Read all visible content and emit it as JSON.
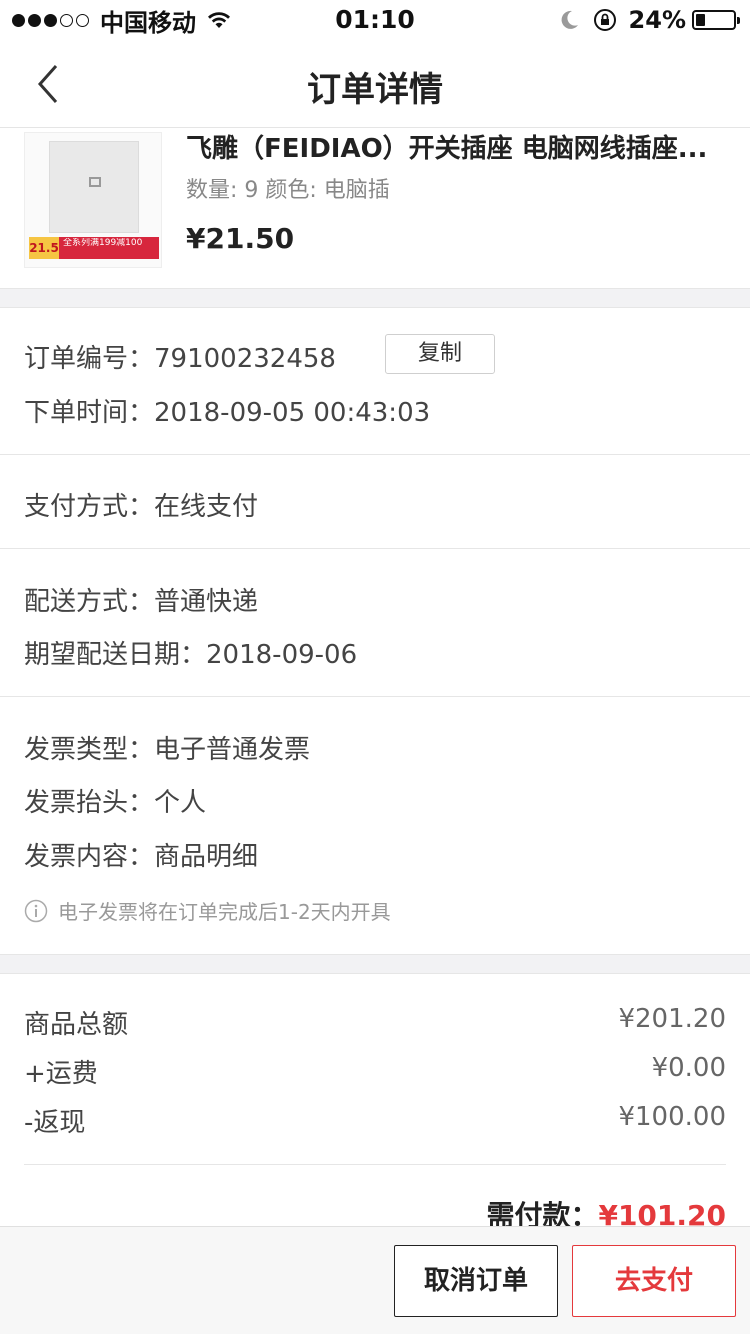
{
  "status_bar": {
    "carrier": "中国移动",
    "time": "01:10",
    "battery_percent": "24%",
    "battery_level": 0.24,
    "signal_bars_filled": 3,
    "signal_bars_total": 5,
    "icons": [
      "wifi-icon",
      "moon-icon",
      "orientation-lock-icon",
      "battery-icon"
    ]
  },
  "nav": {
    "title": "订单详情",
    "back_icon": "chevron-left-icon"
  },
  "product": {
    "title": "飞雕（FEIDIAO）开关插座 电脑网线插座...",
    "spec": "数量: 9 颜色: 电脑插",
    "price": "¥21.50",
    "promo_price": "21.5",
    "promo_text": "全系列满199减100"
  },
  "order": {
    "number_label": "订单编号：",
    "number": "79100232458",
    "copy_label": "复制",
    "time_label": "下单时间：",
    "time": "2018-09-05 00:43:03"
  },
  "payment": {
    "label": "支付方式：",
    "value": "在线支付"
  },
  "delivery": {
    "method_label": "配送方式：",
    "method": "普通快递",
    "date_label": "期望配送日期：",
    "date": "2018-09-06"
  },
  "invoice": {
    "type_label": "发票类型：",
    "type": "电子普通发票",
    "title_label": "发票抬头：",
    "title": "个人",
    "content_label": "发票内容：",
    "content": "商品明细",
    "notice": "电子发票将在订单完成后1-2天内开具"
  },
  "amounts": {
    "goods_label": "商品总额",
    "goods_value": "¥201.20",
    "shipping_label": "+运费",
    "shipping_value": "¥0.00",
    "cashback_label": "-返现",
    "cashback_value": "¥100.00",
    "total_label": "需付款：",
    "total_value": "¥101.20"
  },
  "actions": {
    "cancel_label": "取消订单",
    "pay_label": "去支付"
  },
  "colors": {
    "accent": "#e4393c",
    "background_gap": "#f2f2f4"
  }
}
